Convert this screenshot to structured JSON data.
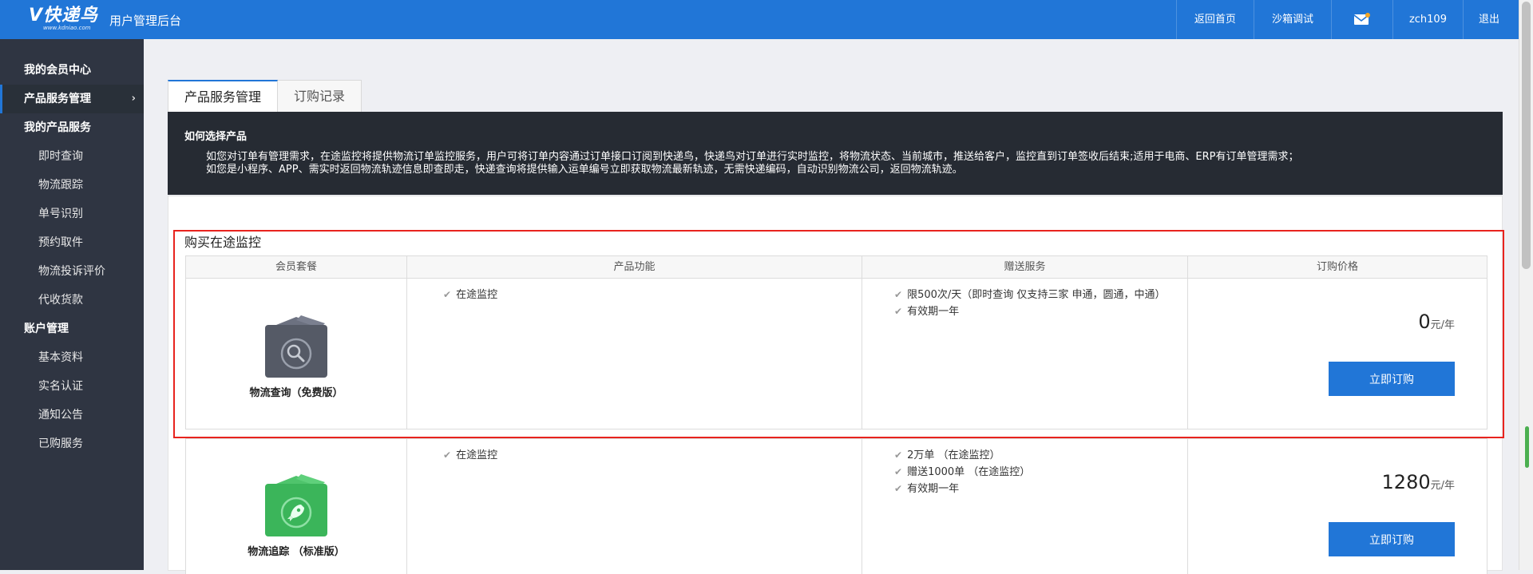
{
  "header": {
    "logo_main": "V快递鸟",
    "logo_sub": "www.kdniao.com",
    "app_title": "用户管理后台",
    "nav": {
      "home": "返回首页",
      "sandbox": "沙箱调试",
      "username": "zch109",
      "logout": "退出"
    },
    "mail_badge_color": "#f5a623"
  },
  "sidebar": {
    "member_center": "我的会员中心",
    "product_service": "产品服务管理",
    "my_products": "我的产品服务",
    "my_products_items": [
      "即时查询",
      "物流跟踪",
      "单号识别",
      "预约取件",
      "物流投诉评价",
      "代收货款"
    ],
    "account": "账户管理",
    "account_items": [
      "基本资料",
      "实名认证",
      "通知公告",
      "已购服务"
    ]
  },
  "tabs": {
    "product_service": "产品服务管理",
    "order_records": "订购记录"
  },
  "info": {
    "title": "如何选择产品",
    "line1": "如您对订单有管理需求，在途监控将提供物流订单监控服务，用户可将订单内容通过订单接口订阅到快递鸟，快递鸟对订单进行实时监控，将物流状态、当前城市，推送给客户，监控直到订单签收后结束;适用于电商、ERP有订单管理需求；",
    "line2": "如您是小程序、APP、需实时返回物流轨迹信息即查即走，快递查询将提供输入运单编号立即获取物流最新轨迹，无需快递编码，自动识别物流公司，返回物流轨迹。"
  },
  "section": {
    "title": "购买在途监控",
    "columns": [
      "会员套餐",
      "产品功能",
      "赠送服务",
      "订购价格"
    ]
  },
  "packages": [
    {
      "name": "物流查询（免费版）",
      "icon": "search-box-icon",
      "color": "#555a66",
      "features": [
        "在途监控"
      ],
      "services": [
        "限500次/天（即时查询 仅支持三家 申通，圆通，中通）",
        "有效期一年"
      ],
      "price": "0",
      "unit": "元/年",
      "button": "立即订购"
    },
    {
      "name": "物流追踪 （标准版）",
      "icon": "rocket-box-icon",
      "color": "#3bb55a",
      "features": [
        "在途监控"
      ],
      "services": [
        "2万单 （在途监控）",
        "赠送1000单 （在途监控）",
        "有效期一年"
      ],
      "price": "1280",
      "unit": "元/年",
      "button": "立即订购"
    }
  ]
}
